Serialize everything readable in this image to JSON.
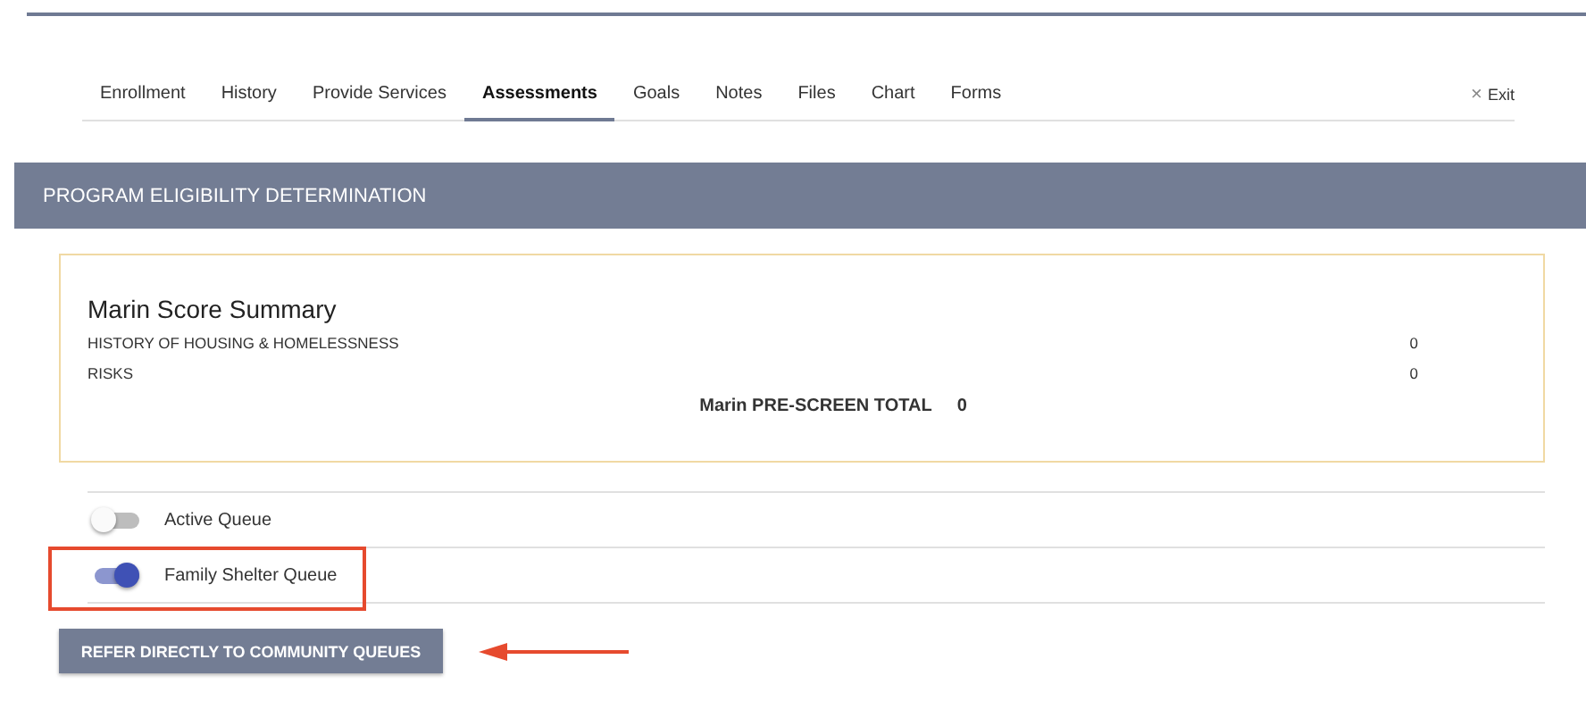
{
  "tabs": [
    {
      "label": "Enrollment",
      "selected": false
    },
    {
      "label": "History",
      "selected": false
    },
    {
      "label": "Provide Services",
      "selected": false
    },
    {
      "label": "Assessments",
      "selected": true
    },
    {
      "label": "Goals",
      "selected": false
    },
    {
      "label": "Notes",
      "selected": false
    },
    {
      "label": "Files",
      "selected": false
    },
    {
      "label": "Chart",
      "selected": false
    },
    {
      "label": "Forms",
      "selected": false
    }
  ],
  "exit": {
    "icon": "×",
    "label": "Exit"
  },
  "section_title": "PROGRAM ELIGIBILITY DETERMINATION",
  "summary": {
    "title": "Marin Score Summary",
    "rows": [
      {
        "label": "HISTORY OF HOUSING & HOMELESSNESS",
        "value": "0"
      },
      {
        "label": "RISKS",
        "value": "0"
      }
    ],
    "total_label": "Marin PRE-SCREEN TOTAL",
    "total_value": "0"
  },
  "toggles": [
    {
      "label": "Active Queue",
      "on": false,
      "highlighted": false
    },
    {
      "label": "Family Shelter Queue",
      "on": true,
      "highlighted": true
    }
  ],
  "refer_button": "REFER DIRECTLY TO COMMUNITY QUEUES"
}
